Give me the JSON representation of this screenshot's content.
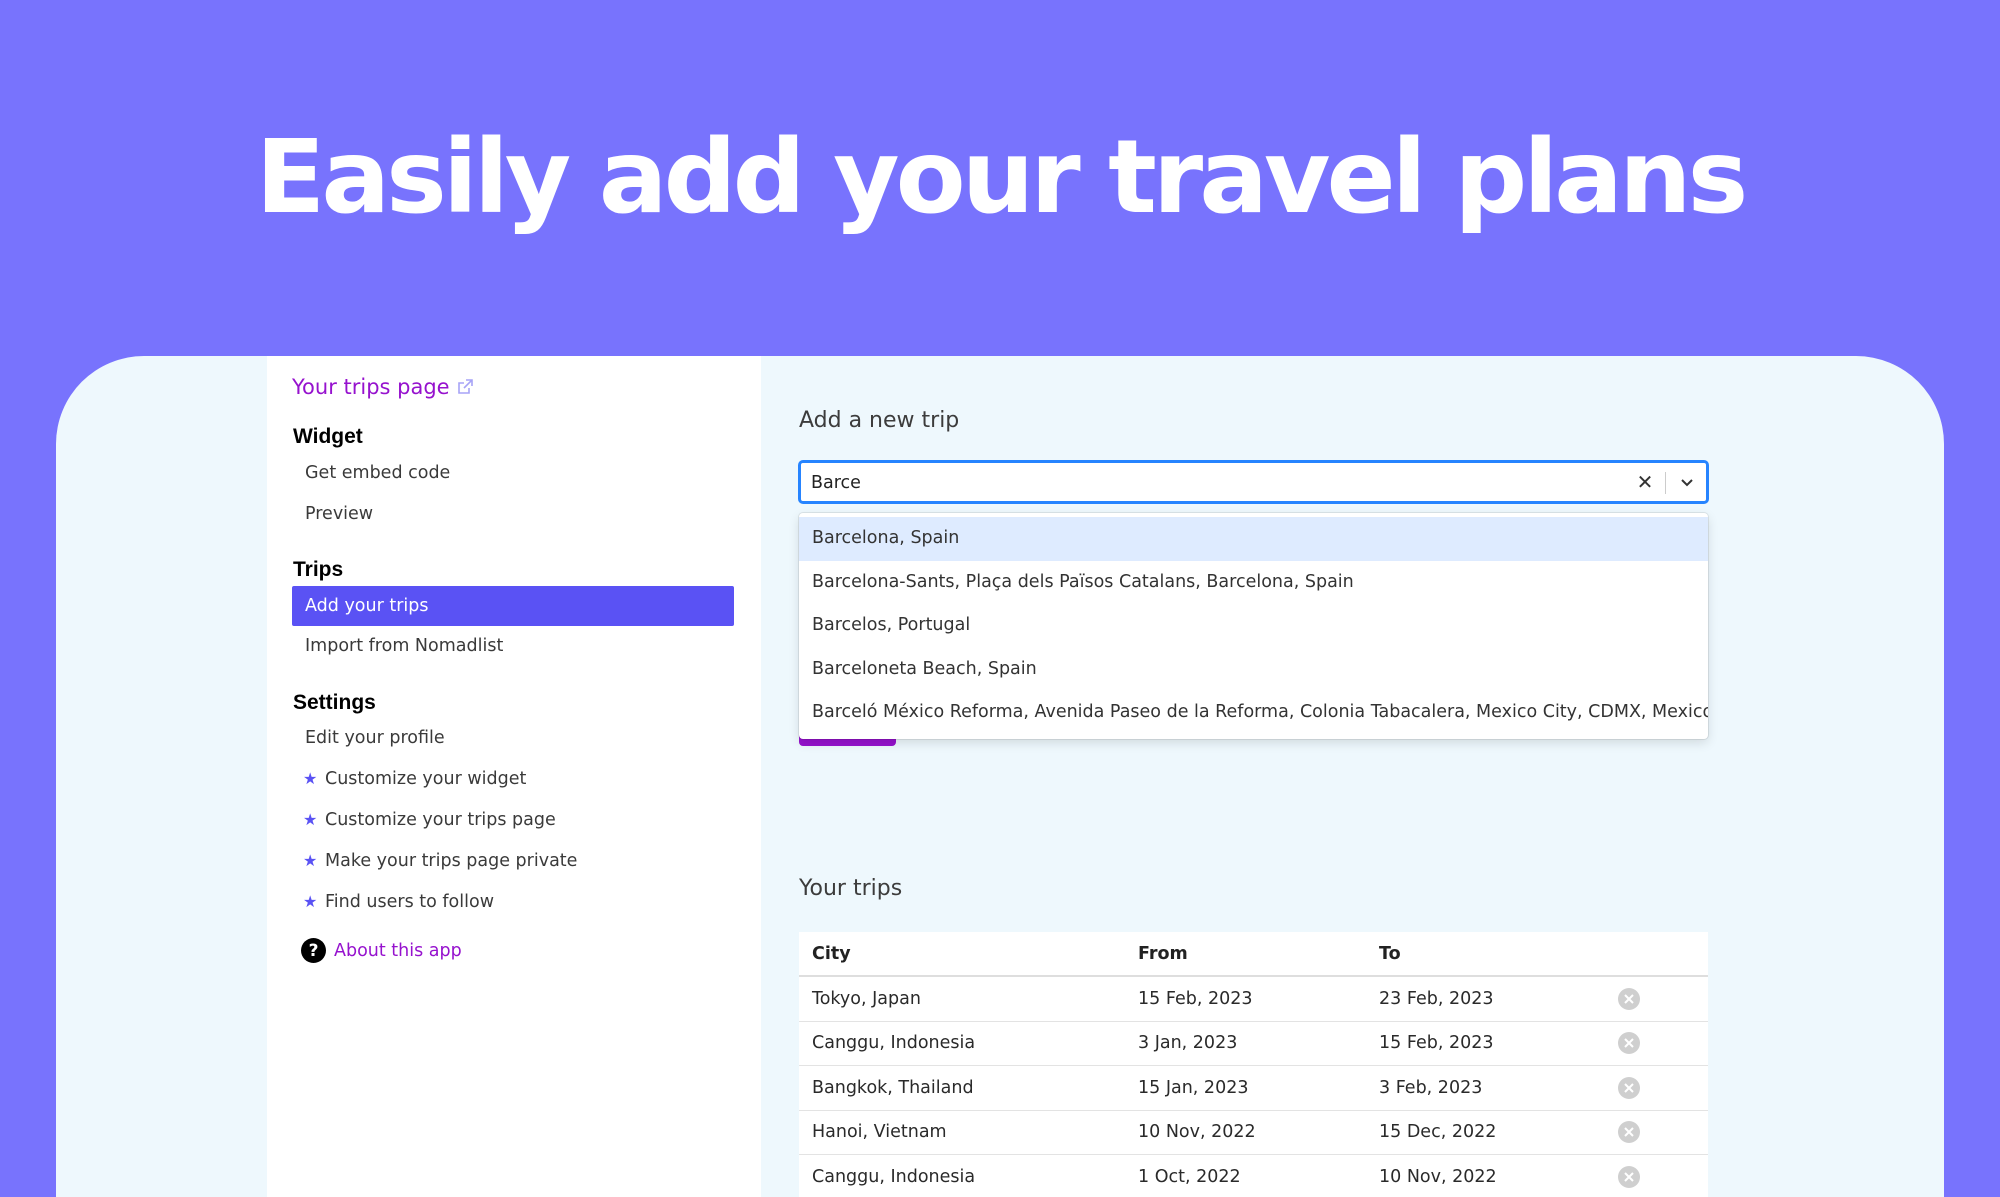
{
  "hero": {
    "title": "Easily add your travel plans"
  },
  "sidebar": {
    "trips_page_link": "Your trips page",
    "sections": [
      {
        "heading": "Widget",
        "items": [
          {
            "label": "Get embed code",
            "starred": false,
            "active": false
          },
          {
            "label": "Preview",
            "starred": false,
            "active": false
          }
        ]
      },
      {
        "heading": "Trips",
        "items": [
          {
            "label": "Add your trips",
            "starred": false,
            "active": true
          },
          {
            "label": "Import from Nomadlist",
            "starred": false,
            "active": false
          }
        ]
      },
      {
        "heading": "Settings",
        "items": [
          {
            "label": "Edit your profile",
            "starred": false,
            "active": false
          },
          {
            "label": "Customize your widget",
            "starred": true,
            "active": false
          },
          {
            "label": "Customize your trips page",
            "starred": true,
            "active": false
          },
          {
            "label": "Make your trips page private",
            "starred": true,
            "active": false
          },
          {
            "label": "Find users to follow",
            "starred": true,
            "active": false
          }
        ]
      }
    ],
    "about_link": "About this app"
  },
  "add_trip": {
    "title": "Add a new trip",
    "search_value": "Barce",
    "options": [
      "Barcelona, Spain",
      "Barcelona-Sants, Plaça dels Països Catalans, Barcelona, Spain",
      "Barcelos, Portugal",
      "Barceloneta Beach, Spain",
      "Barceló México Reforma, Avenida Paseo de la Reforma, Colonia Tabacalera, Mexico City, CDMX, Mexico"
    ]
  },
  "trips": {
    "title": "Your trips",
    "columns": [
      "City",
      "From",
      "To"
    ],
    "rows": [
      {
        "city": "Tokyo, Japan",
        "from": "15 Feb, 2023",
        "to": "23 Feb, 2023"
      },
      {
        "city": "Canggu, Indonesia",
        "from": "3 Jan, 2023",
        "to": "15 Feb, 2023"
      },
      {
        "city": "Bangkok, Thailand",
        "from": "15 Jan, 2023",
        "to": "3 Feb, 2023"
      },
      {
        "city": "Hanoi, Vietnam",
        "from": "10 Nov, 2022",
        "to": "15 Dec, 2022"
      },
      {
        "city": "Canggu, Indonesia",
        "from": "1 Oct, 2022",
        "to": "10 Nov, 2022"
      }
    ]
  },
  "colors": {
    "background": "#7873fd",
    "accent": "#5a52f4",
    "link": "#9612ce",
    "focus": "#2684ff"
  }
}
